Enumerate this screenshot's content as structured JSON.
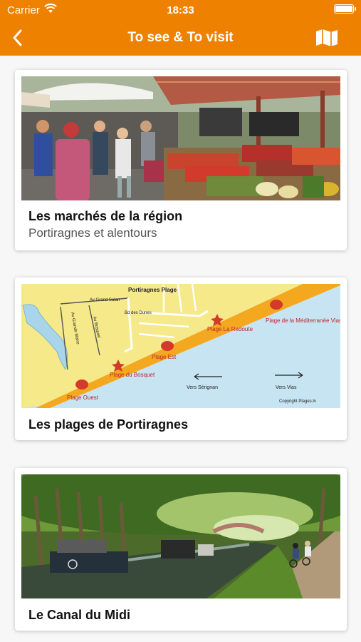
{
  "status_bar": {
    "carrier": "Carrier",
    "time": "18:33"
  },
  "nav": {
    "title": "To see & To visit"
  },
  "items": [
    {
      "title": "Les marchés de la région",
      "subtitle": "Portiragnes et alentours",
      "image": "market-photo"
    },
    {
      "title": "Les plages de Portiragnes",
      "image": "beach-map",
      "map_labels": {
        "place": "Portiragnes Plage",
        "road1": "Av Grand Salan",
        "road2": "Av Grande Maïre",
        "road3": "Av Bosquet",
        "road4": "Bd des Dunes",
        "beach1": "Plage de la Méditerranée Vias",
        "beach2": "Plage La Redoute",
        "beach3": "Plage Est",
        "beach4": "Plage du Bosquet",
        "beach5": "Plage Ouest",
        "dir_left": "Vers Sérignan",
        "dir_right": "Vers Vias",
        "copyright": "Copyright Plages.tv"
      }
    },
    {
      "title": "Le Canal du Midi",
      "image": "canal-photo"
    }
  ],
  "colors": {
    "accent": "#ee8200",
    "background": "#f7f7f7",
    "card": "#ffffff"
  }
}
